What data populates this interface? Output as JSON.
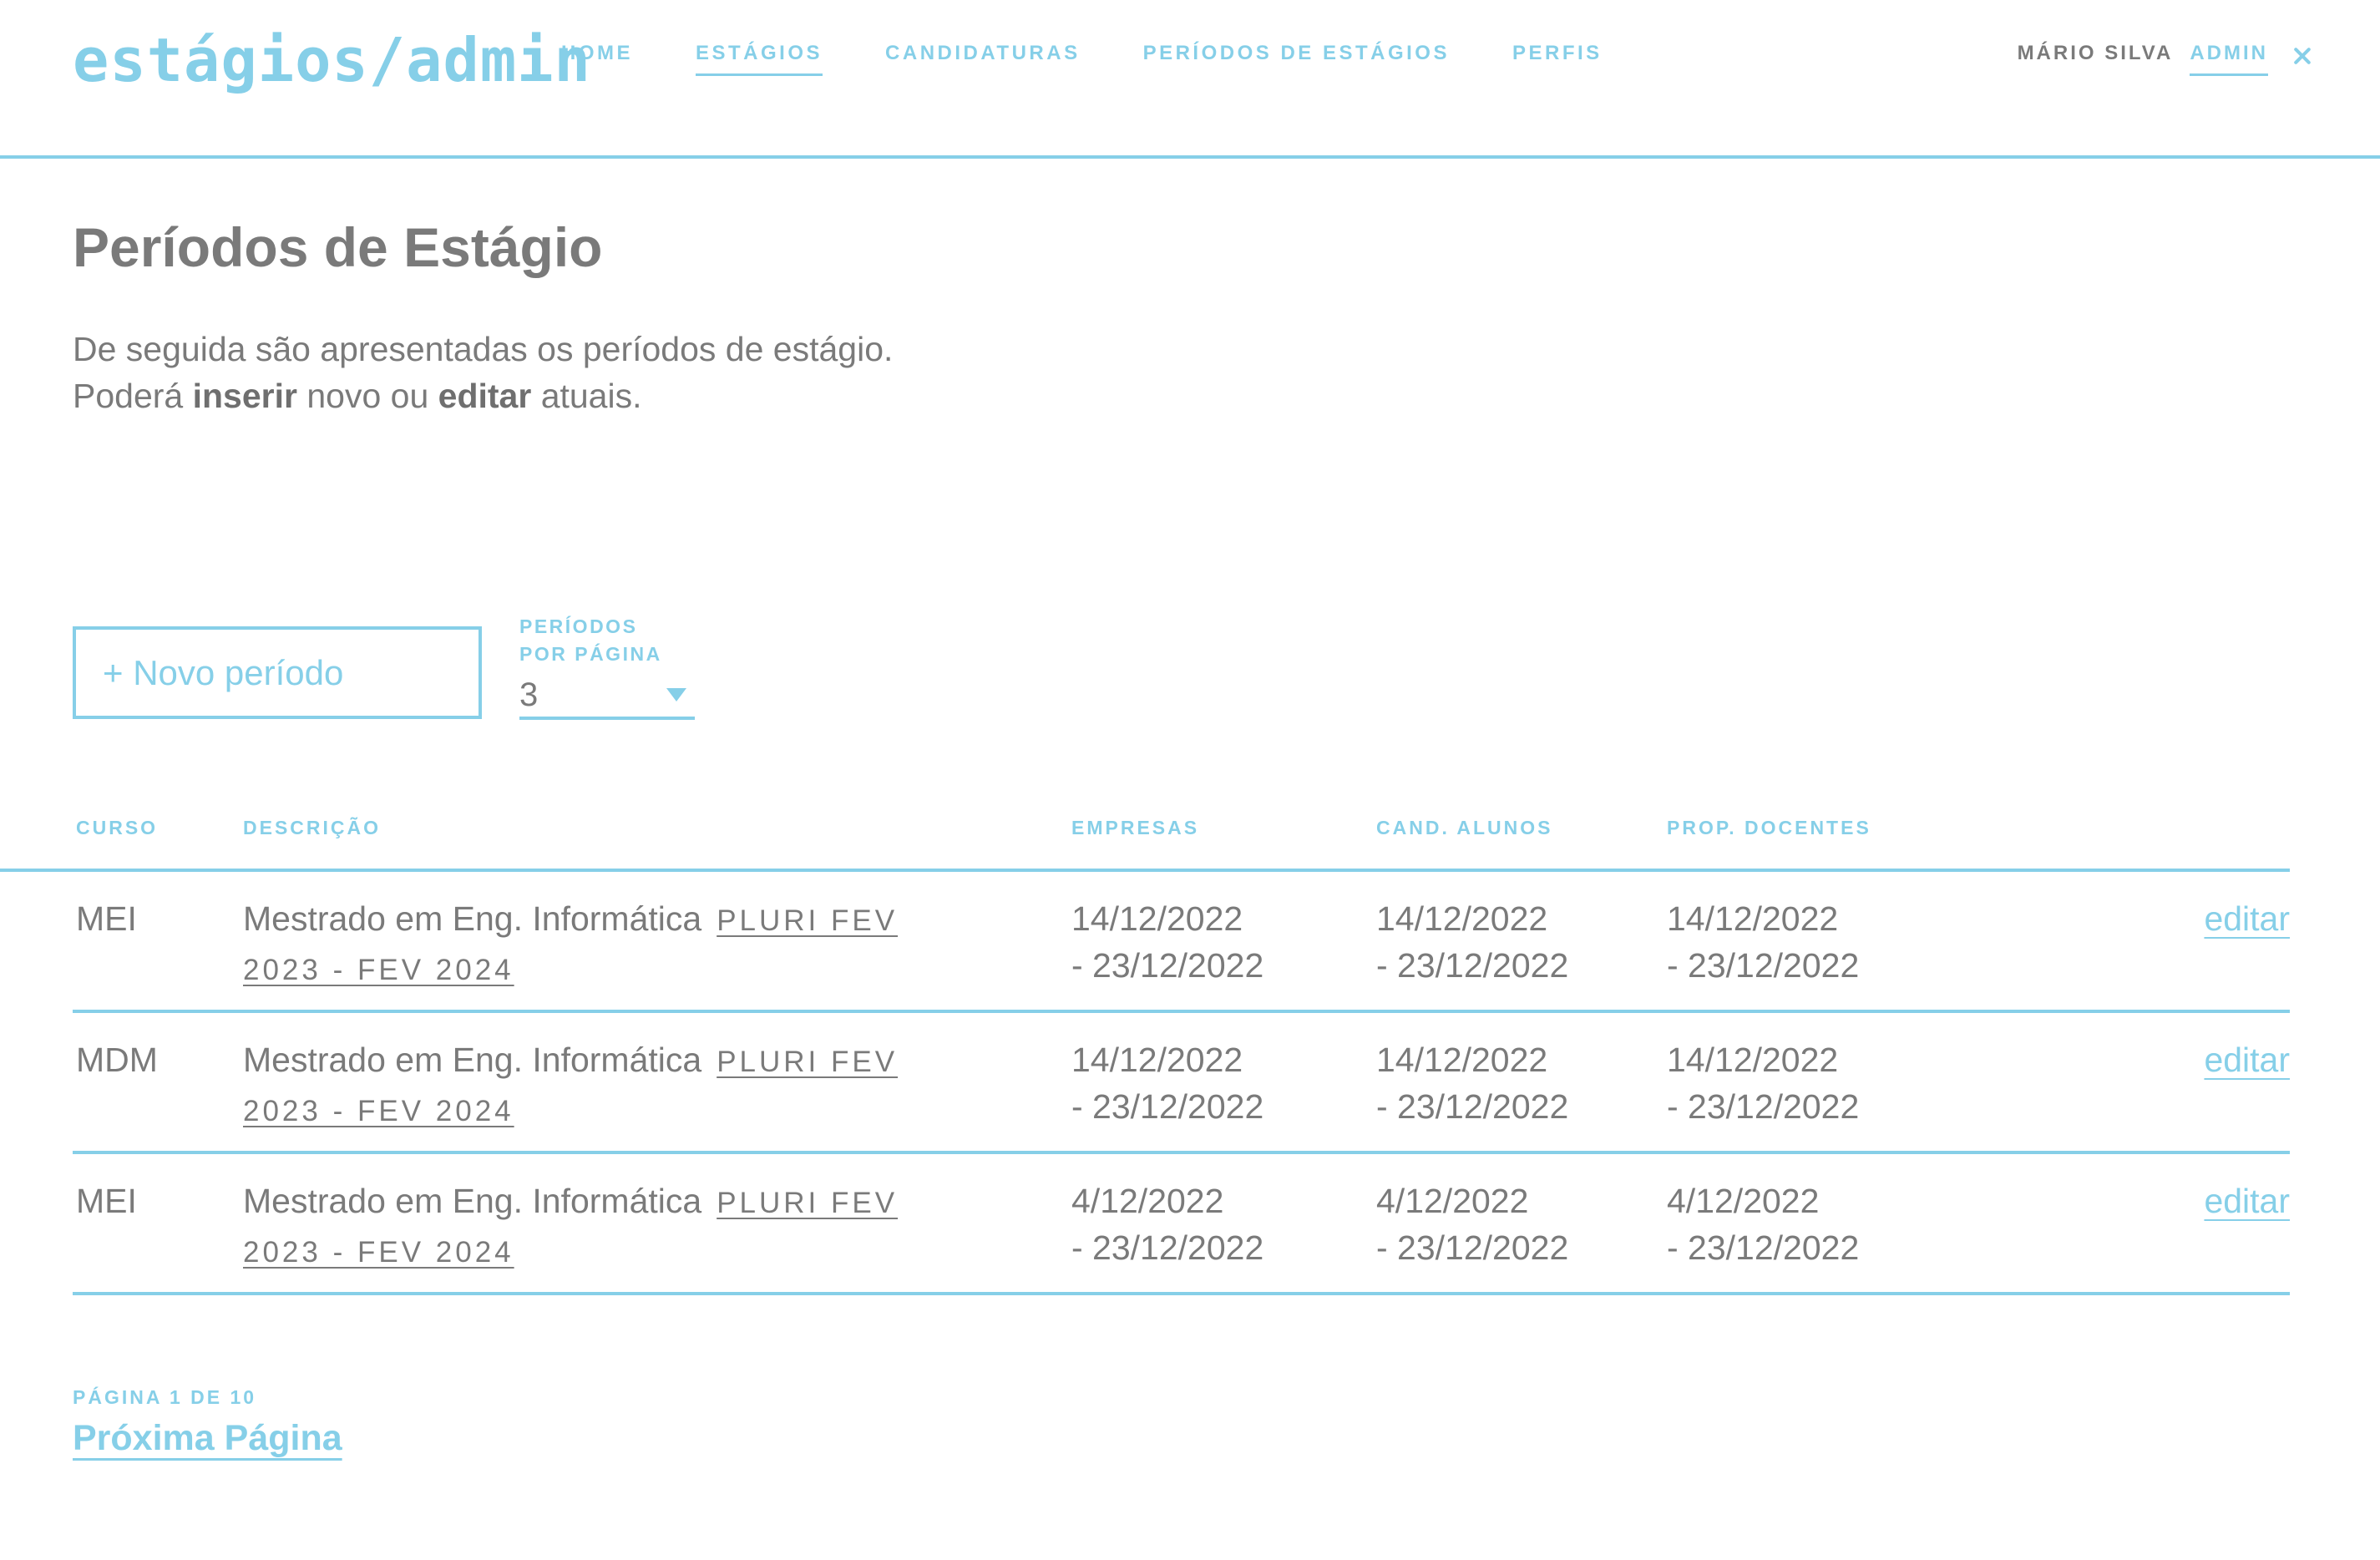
{
  "header": {
    "logo": "estágios/admin",
    "nav": [
      {
        "label": "HOME",
        "active": false
      },
      {
        "label": "ESTÁGIOS",
        "active": true
      },
      {
        "label": "CANDIDATURAS",
        "active": false
      },
      {
        "label": "PERÍODOS DE ESTÁGIOS",
        "active": false
      },
      {
        "label": "PERFIS",
        "active": false
      }
    ],
    "user_name": "MÁRIO SILVA",
    "user_role": "ADMIN",
    "close_icon": "close-icon"
  },
  "page": {
    "title": "Períodos de Estágio",
    "intro_line1": "De seguida são apresentadas os períodos de estágio.",
    "intro_line2_pre": "Poderá ",
    "intro_line2_b1": "inserir",
    "intro_line2_mid": " novo ou ",
    "intro_line2_b2": "editar",
    "intro_line2_post": " atuais."
  },
  "controls": {
    "new_button": "+ Novo período",
    "per_page_label_1": "PERÍODOS",
    "per_page_label_2": "POR PÁGINA",
    "per_page_value": "3"
  },
  "table": {
    "headers": {
      "curso": "CURSO",
      "descricao": "DESCRIÇÃO",
      "empresas": "EMPRESAS",
      "cand_alunos": "CAND. ALUNOS",
      "prop_docentes": "PROP. DOCENTES"
    },
    "rows": [
      {
        "curso": "MEI",
        "descricao": "Mestrado em Eng. Informática",
        "periodo": "PLURI FEV 2023 - FEV 2024",
        "empresas_1": "14/12/2022",
        "empresas_2": "- 23/12/2022",
        "cand_1": "14/12/2022",
        "cand_2": "- 23/12/2022",
        "prop_1": "14/12/2022",
        "prop_2": "- 23/12/2022",
        "edit": "editar"
      },
      {
        "curso": "MDM",
        "descricao": "Mestrado em Eng. Informática",
        "periodo": "PLURI FEV 2023 - FEV 2024",
        "empresas_1": "14/12/2022",
        "empresas_2": "- 23/12/2022",
        "cand_1": "14/12/2022",
        "cand_2": "- 23/12/2022",
        "prop_1": "14/12/2022",
        "prop_2": "- 23/12/2022",
        "edit": "editar"
      },
      {
        "curso": "MEI",
        "descricao": "Mestrado em Eng. Informática",
        "periodo": "PLURI FEV 2023 - FEV 2024",
        "empresas_1": "4/12/2022",
        "empresas_2": "- 23/12/2022",
        "cand_1": "4/12/2022",
        "cand_2": "- 23/12/2022",
        "prop_1": "4/12/2022",
        "prop_2": "- 23/12/2022",
        "edit": "editar"
      }
    ]
  },
  "pagination": {
    "info": "PÁGINA 1 DE 10",
    "next": "Próxima Página"
  },
  "colors": {
    "accent": "#86cfe8",
    "text": "#7a7a7a"
  }
}
